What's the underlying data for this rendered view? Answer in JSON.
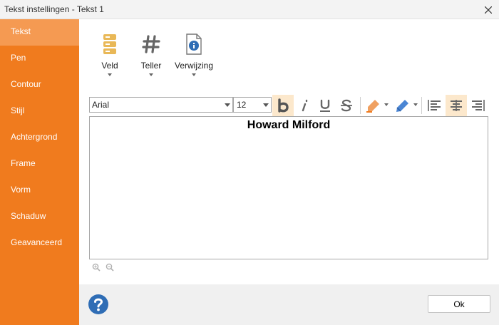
{
  "window": {
    "title": "Tekst instellingen - Tekst 1"
  },
  "sidebar": {
    "items": [
      {
        "label": "Tekst",
        "active": true
      },
      {
        "label": "Pen"
      },
      {
        "label": "Contour"
      },
      {
        "label": "Stijl"
      },
      {
        "label": "Achtergrond"
      },
      {
        "label": "Frame"
      },
      {
        "label": "Vorm"
      },
      {
        "label": "Schaduw"
      },
      {
        "label": "Geavanceerd"
      }
    ]
  },
  "ribbon": {
    "buttons": [
      {
        "label": "Veld",
        "icon": "database-icon"
      },
      {
        "label": "Teller",
        "icon": "hash-icon"
      },
      {
        "label": "Verwijzing",
        "icon": "document-info-icon"
      }
    ]
  },
  "format_toolbar": {
    "font": "Arial",
    "font_size": "12",
    "bold_active": true,
    "align_center_active": true
  },
  "editor": {
    "text": "Howard Milford"
  },
  "footer": {
    "ok_label": "Ok"
  },
  "colors": {
    "sidebar": "#f07b1e",
    "sidebar_active": "#f59a52",
    "active_button_bg": "#fce8cc",
    "help_icon": "#2f6db5"
  }
}
